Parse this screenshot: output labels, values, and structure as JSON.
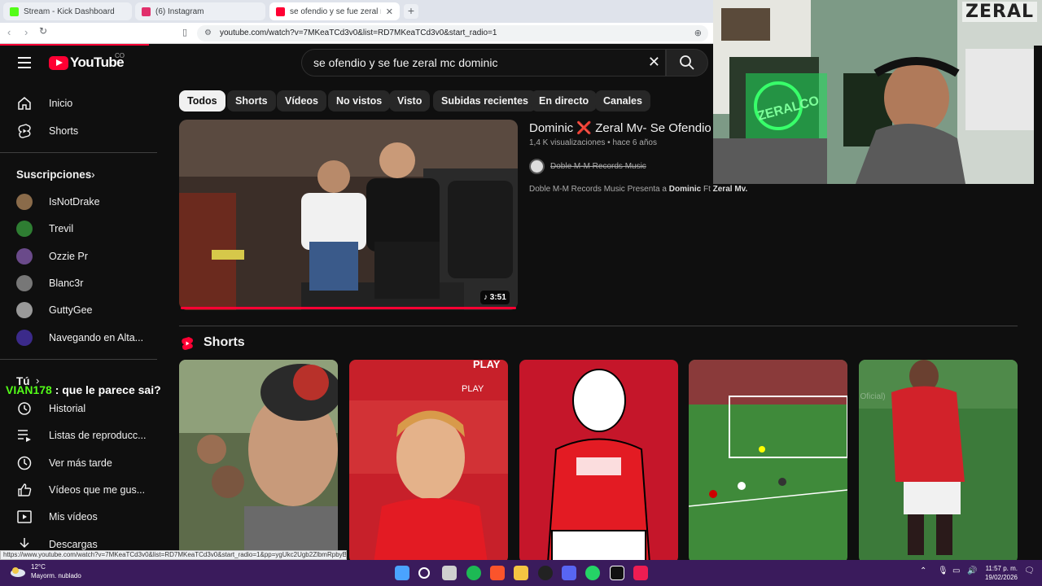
{
  "browser": {
    "tabs": [
      {
        "label": "Stream - Kick Dashboard",
        "favicon_color": "#53fc18"
      },
      {
        "label": "(6) Instagram",
        "favicon_color": "#e1306c"
      },
      {
        "label": "se ofendio y se fue zeral mc dom",
        "favicon_color": "#ff0033"
      }
    ],
    "new_tab": "+",
    "url": "youtube.com/watch?v=7MKeaTCd3v0&list=RD7MKeaTCd3v0&start_radio=1",
    "status_url": "https://www.youtube.com/watch?v=7MKeaTCd3v0&list=RD7MKeaTCd3v0&start_radio=1&pp=ygUkc2Ugb2ZlbmRpbyB5IHNlIGZ1ZSB6ZXJhbCBtYyBkb21pbmlj"
  },
  "header": {
    "logo_text": "YouTube",
    "country": "CO",
    "search_value": "se ofendio y se fue zeral mc dominic"
  },
  "sidebar": {
    "main": [
      {
        "label": "Inicio",
        "icon": "home-icon"
      },
      {
        "label": "Shorts",
        "icon": "shorts-icon"
      }
    ],
    "subscriptions_title": "Suscripciones",
    "subscriptions": [
      {
        "label": "IsNotDrake",
        "color": "#8a6b4a"
      },
      {
        "label": "Trevil",
        "color": "#2e7d32"
      },
      {
        "label": "Ozzie Pr",
        "color": "#6a4a8a"
      },
      {
        "label": "Blanc3r",
        "color": "#777777"
      },
      {
        "label": "GuttyGee",
        "color": "#999999"
      },
      {
        "label": "Navegando en Alta...",
        "color": "#3b2a8a"
      }
    ],
    "you_title": "Tú",
    "you_items": [
      {
        "label": "Historial",
        "icon": "history-icon"
      },
      {
        "label": "Listas de reproducc...",
        "icon": "playlist-icon"
      },
      {
        "label": "Ver más tarde",
        "icon": "clock-icon"
      },
      {
        "label": "Vídeos que me gus...",
        "icon": "thumbs-up-icon"
      },
      {
        "label": "Mis vídeos",
        "icon": "my-videos-icon"
      },
      {
        "label": "Descargas",
        "icon": "download-icon"
      }
    ]
  },
  "chat_overlay": {
    "user": "VIAN178",
    "message": " : que le parece sai?"
  },
  "filters": [
    "Todos",
    "Shorts",
    "Vídeos",
    "No vistos",
    "Visto",
    "Subidas recientes",
    "En directo",
    "Canales"
  ],
  "video": {
    "title": "Dominic ❌ Zeral Mv- Se Ofendio",
    "views": "1,4 K visualizaciones",
    "age": "hace 6 años",
    "channel": "Doble M-M Records Music",
    "description_prefix": "Doble M-M Records Music Presenta a ",
    "description_bold1": "Dominic",
    "description_mid": " Ft ",
    "description_bold2": "Zeral Mv.",
    "duration": "3:51",
    "progress_fraction": 1.0
  },
  "shorts": {
    "title": "Shorts",
    "cards": [
      {
        "overlay": ""
      },
      {
        "overlay": "PLAY"
      },
      {
        "overlay": ""
      },
      {
        "overlay": ""
      },
      {
        "overlay": "(Video Oficial)"
      }
    ]
  },
  "webcam": {
    "name_tag": "ZERAL",
    "sign_text": "ZERALCO"
  },
  "taskbar": {
    "temp": "12°C",
    "weather": "Mayorm. nublado",
    "time": "11:57 p. m.",
    "date": "19/02/2026"
  }
}
